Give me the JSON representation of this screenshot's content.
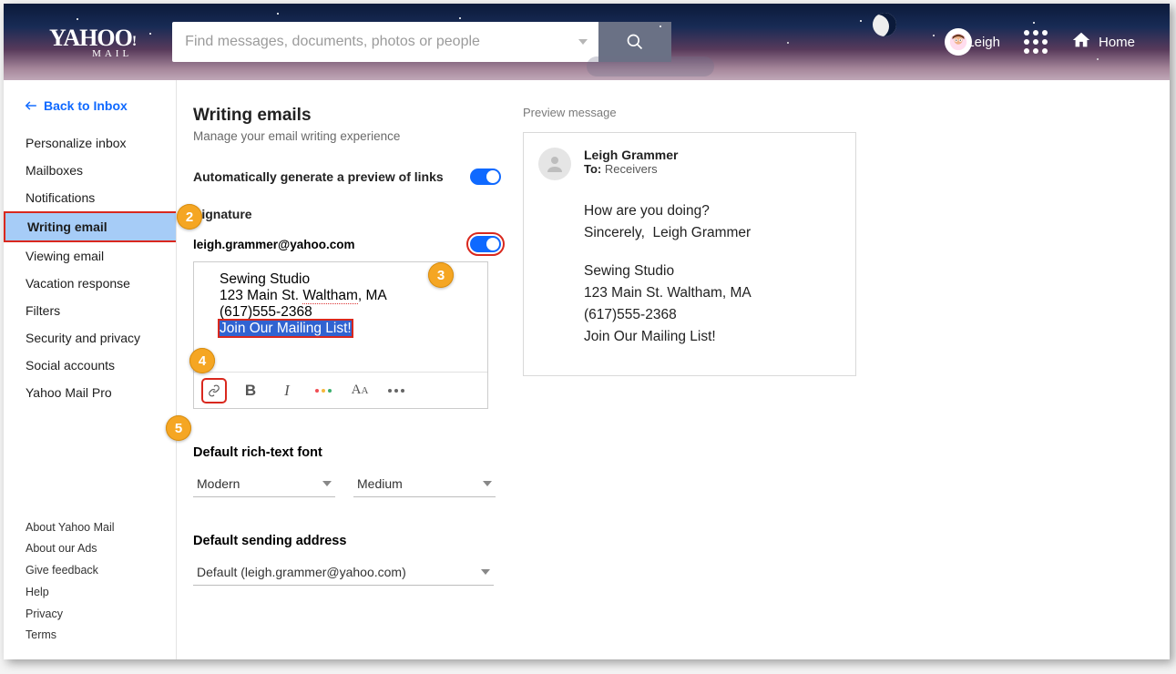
{
  "header": {
    "logo_main": "YAHOO",
    "logo_bang": "!",
    "logo_sub": "MAIL",
    "search_placeholder": "Find messages, documents, photos or people",
    "user_name": "Leigh",
    "home_label": "Home"
  },
  "sidebar": {
    "back_label": "Back to Inbox",
    "items": [
      "Personalize inbox",
      "Mailboxes",
      "Notifications",
      "Writing email",
      "Viewing email",
      "Vacation response",
      "Filters",
      "Security and privacy",
      "Social accounts",
      "Yahoo Mail Pro"
    ],
    "footer": [
      "About Yahoo Mail",
      "About our Ads",
      "Give feedback",
      "Help",
      "Privacy",
      "Terms"
    ]
  },
  "settings": {
    "title": "Writing emails",
    "subtitle": "Manage your email writing experience",
    "auto_preview_label": "Automatically generate a preview of links",
    "signature_heading": "Signature",
    "signature_email": "leigh.grammer@yahoo.com",
    "signature_lines": {
      "l1": "Sewing Studio",
      "l2a": "123 Main St. ",
      "l2b": "Waltham",
      "l2c": ", MA",
      "l3": "(617)555-2368",
      "l4": "Join Our Mailing List!"
    },
    "font_heading": "Default rich-text font",
    "font_family": "Modern",
    "font_size": "Medium",
    "sending_heading": "Default sending address",
    "sending_value": "Default (leigh.grammer@yahoo.com)"
  },
  "preview": {
    "label": "Preview message",
    "sender": "Leigh Grammer",
    "to_label": "To:",
    "receivers": "Receivers",
    "body_q": "How are you doing?",
    "body_sign": "Sincerely,",
    "body_name": "Leigh Grammer",
    "sig1": "Sewing Studio",
    "sig2": "123 Main St. Waltham, MA",
    "sig3": "(617)555-2368",
    "sig4": "Join Our Mailing List!"
  },
  "callouts": {
    "c2": "2",
    "c3": "3",
    "c4": "4",
    "c5": "5"
  }
}
